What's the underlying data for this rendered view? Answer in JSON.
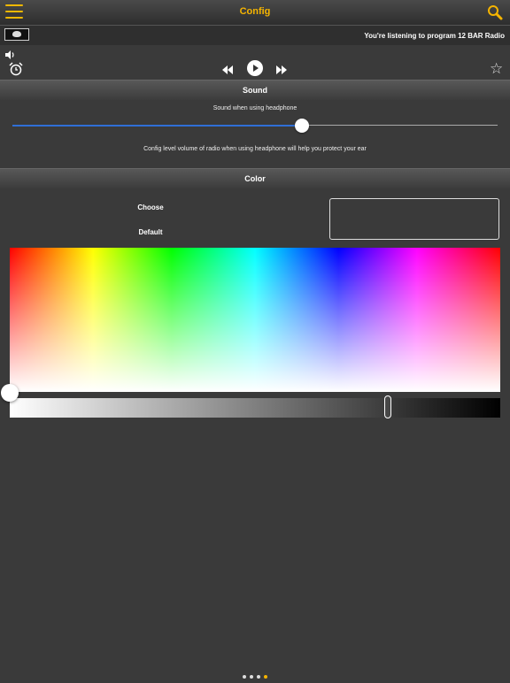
{
  "header": {
    "title": "Config",
    "menu_icon": "hamburger-menu-icon",
    "search_icon": "search-icon",
    "accent_color": "#f5b400"
  },
  "now_playing": {
    "text": "You're listening to program 12 BAR Radio"
  },
  "player": {
    "volume_icon": "speaker-icon",
    "alarm_icon": "alarm-clock-icon",
    "rewind_icon": "rewind-icon",
    "play_icon": "play-icon",
    "forward_icon": "fast-forward-icon",
    "favorite_icon": "star-icon"
  },
  "sound": {
    "header": "Sound",
    "slider_label": "Sound when using headphone",
    "slider_value_fraction": 0.6,
    "slider_color": "#2f6fd6",
    "description": "Config level volume of radio when using headphone will help you protect your ear"
  },
  "color": {
    "header": "Color",
    "choose_label": "Choose",
    "default_label": "Default",
    "brightness_value_fraction": 0.77
  },
  "pager": {
    "count": 4,
    "active_index": 3
  }
}
